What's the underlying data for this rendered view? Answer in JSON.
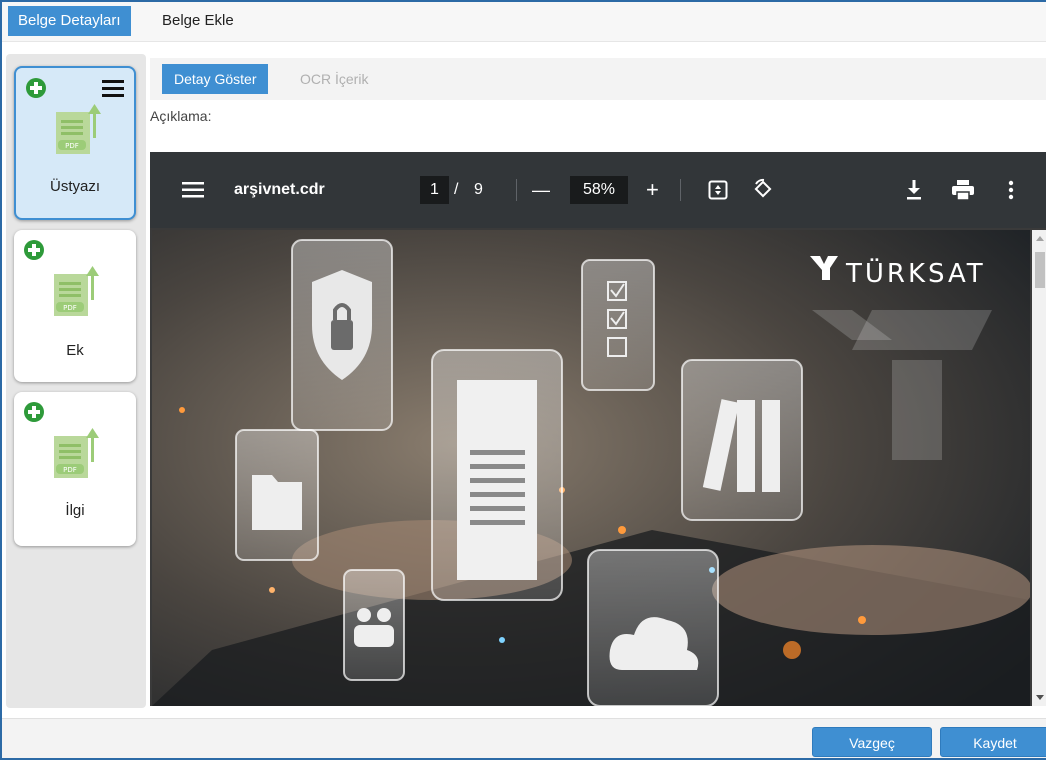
{
  "top_tabs": {
    "details": "Belge Detayları",
    "add": "Belge Ekle"
  },
  "documents": [
    {
      "label": "Üstyazı",
      "pdf_tag": "PDF",
      "active": true
    },
    {
      "label": "Ek",
      "pdf_tag": "PDF",
      "active": false
    },
    {
      "label": "İlgi",
      "pdf_tag": "PDF",
      "active": false
    }
  ],
  "sub_tabs": {
    "detail": "Detay Göster",
    "ocr": "OCR İçerik"
  },
  "description_label": "Açıklama:",
  "viewer": {
    "file_name": "arşivnet.cdr",
    "current_page": "1",
    "page_sep": "/",
    "total_pages": "9",
    "zoom": "58%",
    "minus": "—",
    "plus": "+"
  },
  "brand_text": "TÜRKSAT",
  "footer": {
    "cancel": "Vazgeç",
    "save": "Kaydet"
  },
  "colors": {
    "accent": "#3f8fd2",
    "plus_green": "#2e9a3a",
    "toolbar": "#323639"
  },
  "icons": [
    "plus-circle-icon",
    "hamburger-menu-icon",
    "pdf-file-icon",
    "fit-page-icon",
    "rotate-icon",
    "download-icon",
    "print-icon",
    "more-vert-icon"
  ]
}
